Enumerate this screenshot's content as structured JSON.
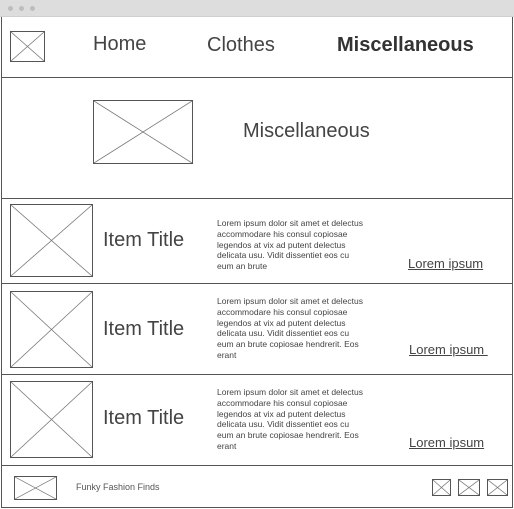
{
  "nav": {
    "items": [
      "Home",
      "Clothes",
      "Miscellaneous"
    ],
    "active": "Miscellaneous"
  },
  "hero": {
    "title": "Miscellaneous"
  },
  "items": [
    {
      "title": "Item Title",
      "description": "Lorem ipsum dolor sit amet et delectus accommodare his consul copiosae legendos at vix ad putent delectus delicata usu. Vidit dissentiet eos cu eum an brute",
      "link": "Lorem ipsum"
    },
    {
      "title": "Item Title",
      "description": "Lorem ipsum dolor sit amet et delectus accommodare his consul copiosae legendos at vix ad putent delectus delicata usu. Vidit dissentiet eos cu eum an brute copiosae hendrerit. Eos erant",
      "link": "Lorem ipsum "
    },
    {
      "title": "Item Title",
      "description": "Lorem ipsum dolor sit amet et delectus accommodare his consul copiosae legendos at vix ad putent delectus delicata usu. Vidit dissentiet eos cu eum an brute copiosae hendrerit. Eos erant",
      "link": "Lorem ipsum"
    }
  ],
  "footer": {
    "brand": "Funky Fashion Finds"
  }
}
